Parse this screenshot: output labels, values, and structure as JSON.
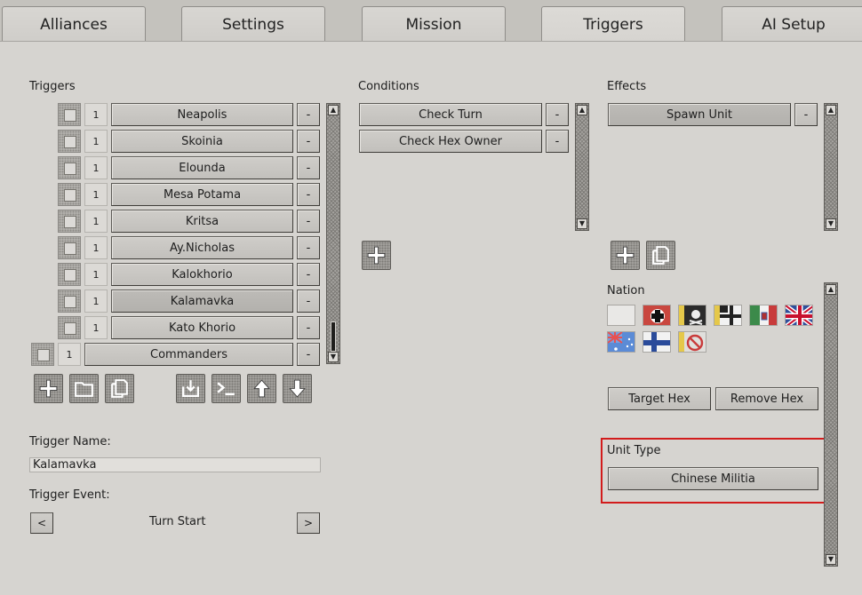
{
  "tabs": [
    {
      "label": "Alliances"
    },
    {
      "label": "Settings"
    },
    {
      "label": "Mission"
    },
    {
      "label": "Triggers",
      "active": true
    },
    {
      "label": "AI Setup"
    }
  ],
  "triggers": {
    "heading": "Triggers",
    "items": [
      {
        "count": "1",
        "name": "Neapolis",
        "minus": "-"
      },
      {
        "count": "1",
        "name": "Skoinia",
        "minus": "-"
      },
      {
        "count": "1",
        "name": "Elounda",
        "minus": "-"
      },
      {
        "count": "1",
        "name": "Mesa Potama",
        "minus": "-"
      },
      {
        "count": "1",
        "name": "Kritsa",
        "minus": "-"
      },
      {
        "count": "1",
        "name": "Ay.Nicholas",
        "minus": "-"
      },
      {
        "count": "1",
        "name": "Kalokhorio",
        "minus": "-"
      },
      {
        "count": "1",
        "name": "Kalamavka",
        "minus": "-",
        "selected": true
      },
      {
        "count": "1",
        "name": "Kato Khorio",
        "minus": "-"
      },
      {
        "count": "1",
        "name": "Commanders",
        "minus": "-",
        "outdented": true
      }
    ],
    "toolbar": [
      "add-icon",
      "folder-icon",
      "copy-icon",
      "import-icon",
      "console-icon",
      "arrow-up-icon",
      "arrow-down-icon"
    ]
  },
  "trigger_name": {
    "label": "Trigger Name:",
    "value": "Kalamavka"
  },
  "trigger_event": {
    "label": "Trigger Event:",
    "value": "Turn Start",
    "prev": "<",
    "next": ">"
  },
  "conditions": {
    "heading": "Conditions",
    "items": [
      {
        "name": "Check Turn",
        "minus": "-"
      },
      {
        "name": "Check Hex Owner",
        "minus": "-"
      }
    ]
  },
  "effects": {
    "heading": "Effects",
    "items": [
      {
        "name": "Spawn Unit",
        "minus": "-",
        "selected": true
      }
    ]
  },
  "nation": {
    "label": "Nation",
    "flags": [
      "blank-flag",
      "german-cross-roundel-flag",
      "pirate-skull-flag",
      "imperial-german-war-flag",
      "italian-kingdom-flag",
      "union-jack-flag",
      "australian-flag",
      "finnish-cross-flag",
      "no-nation-flag"
    ]
  },
  "hex_buttons": {
    "target": "Target Hex",
    "remove": "Remove Hex"
  },
  "unit_type": {
    "label": "Unit Type",
    "value": "Chinese Militia"
  },
  "colors": {
    "highlight": "#d21c1c",
    "panel": "#d6d4d0"
  }
}
